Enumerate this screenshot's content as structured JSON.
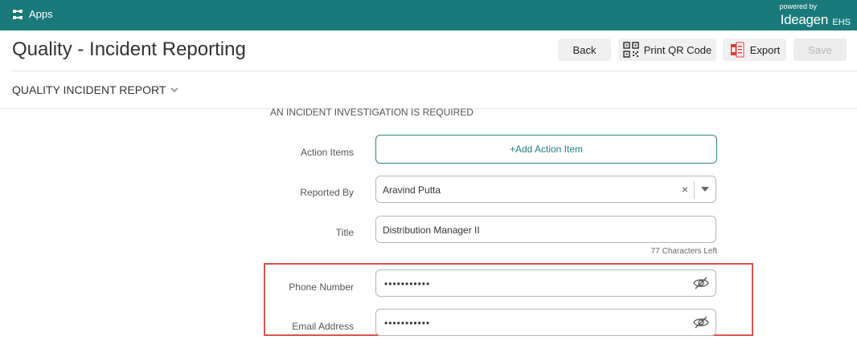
{
  "topbar": {
    "apps_label": "Apps",
    "powered_by": "powered by",
    "brand_logo": "Ideagen",
    "brand_suffix": "EHS",
    "bg_color": "#1a7a7a"
  },
  "header": {
    "title": "Quality - Incident Reporting",
    "buttons": {
      "back": "Back",
      "print_qr": "Print QR Code",
      "export": "Export",
      "save": "Save"
    }
  },
  "section": {
    "title": "QUALITY INCIDENT REPORT"
  },
  "form": {
    "note": "AN INCIDENT INVESTIGATION IS REQUIRED",
    "action_items": {
      "label": "Action Items",
      "button": "+Add Action Item"
    },
    "reported_by": {
      "label": "Reported By",
      "value": "Aravind Putta",
      "clear": "×"
    },
    "title_field": {
      "label": "Title",
      "value": "Distribution Manager II",
      "chars_left": "77 Characters Left"
    },
    "phone": {
      "label": "Phone Number",
      "value": "•••••••••••"
    },
    "email": {
      "label": "Email Address",
      "value": "•••••••••••"
    }
  },
  "icons": {
    "apps": "apps-grid-icon",
    "qr": "qr-code-icon",
    "pdf": "pdf-icon",
    "chevron": "chevron-down-icon",
    "eye_off": "eye-off-icon"
  },
  "colors": {
    "accent": "#1f7f7f",
    "highlight": "#d9534f"
  }
}
